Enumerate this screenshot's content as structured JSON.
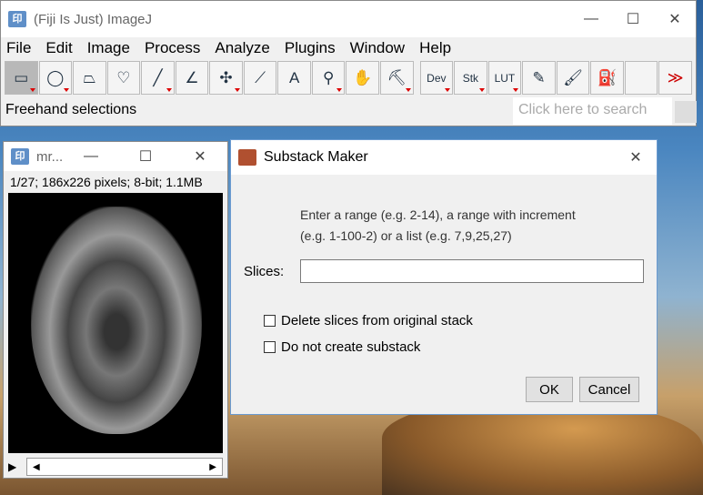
{
  "main": {
    "title": "(Fiji Is Just) ImageJ",
    "menu": [
      "File",
      "Edit",
      "Image",
      "Process",
      "Analyze",
      "Plugins",
      "Window",
      "Help"
    ],
    "tools": [
      {
        "name": "rectangle",
        "g": "▭",
        "sel": true,
        "tri": true
      },
      {
        "name": "oval",
        "g": "◯",
        "tri": true
      },
      {
        "name": "polygon",
        "g": "⏢"
      },
      {
        "name": "freehand",
        "g": "♡"
      },
      {
        "name": "line",
        "g": "╱",
        "tri": true
      },
      {
        "name": "angle",
        "g": "∠"
      },
      {
        "name": "multipoint",
        "g": "✣",
        "tri": true
      },
      {
        "name": "wand",
        "g": "⟋"
      },
      {
        "name": "text",
        "g": "A"
      },
      {
        "name": "magnifier",
        "g": "⚲",
        "tri": true
      },
      {
        "name": "hand",
        "g": "✋"
      },
      {
        "name": "color-picker",
        "g": "⛏",
        "tri": true
      },
      {
        "name": "dev",
        "g": "Dev",
        "tri": true
      },
      {
        "name": "stk",
        "g": "Stk",
        "tri": true
      },
      {
        "name": "lut",
        "g": "LUT",
        "tri": true
      },
      {
        "name": "pencil",
        "g": "✎"
      },
      {
        "name": "brush",
        "g": "🖌"
      },
      {
        "name": "flood-fill",
        "g": "⛽"
      },
      {
        "name": "blank",
        "g": ""
      },
      {
        "name": "more",
        "g": "≫"
      }
    ],
    "status": "Freehand selections",
    "search_placeholder": "Click here to search"
  },
  "image": {
    "title": "mr...",
    "info": "1/27; 186x226 pixels; 8-bit; 1.1MB"
  },
  "dialog": {
    "title": "Substack Maker",
    "line1": "Enter a range (e.g. 2-14), a range with increment",
    "line2": "(e.g. 1-100-2) or a list (e.g. 7,9,25,27)",
    "slices_label": "Slices:",
    "slices_value": "",
    "opt1": "Delete slices from original stack",
    "opt2": "Do not create substack",
    "ok": "OK",
    "cancel": "Cancel"
  }
}
